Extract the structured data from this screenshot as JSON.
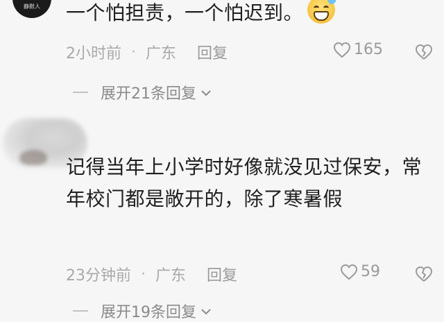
{
  "comments": [
    {
      "avatar_label": "静默人",
      "text": "一个怕担责，一个怕迟到。",
      "emoji": "grinning-sweat-emoji",
      "time": "2小时前",
      "separator": "·",
      "location": "广东",
      "reply_label": "回复",
      "likes": "165",
      "expand_label": "展开21条回复"
    },
    {
      "text": "记得当年上小学时好像就没见过保安，常年校门都是敞开的，除了寒暑假",
      "time": "23分钟前",
      "separator": "·",
      "location": "广东",
      "reply_label": "回复",
      "likes": "59",
      "expand_label": "展开19条回复"
    }
  ],
  "colors": {
    "background": "#f6f6f6",
    "text": "#1f1f1f",
    "meta": "#a9a9a9",
    "expand": "#8a8a8a"
  }
}
